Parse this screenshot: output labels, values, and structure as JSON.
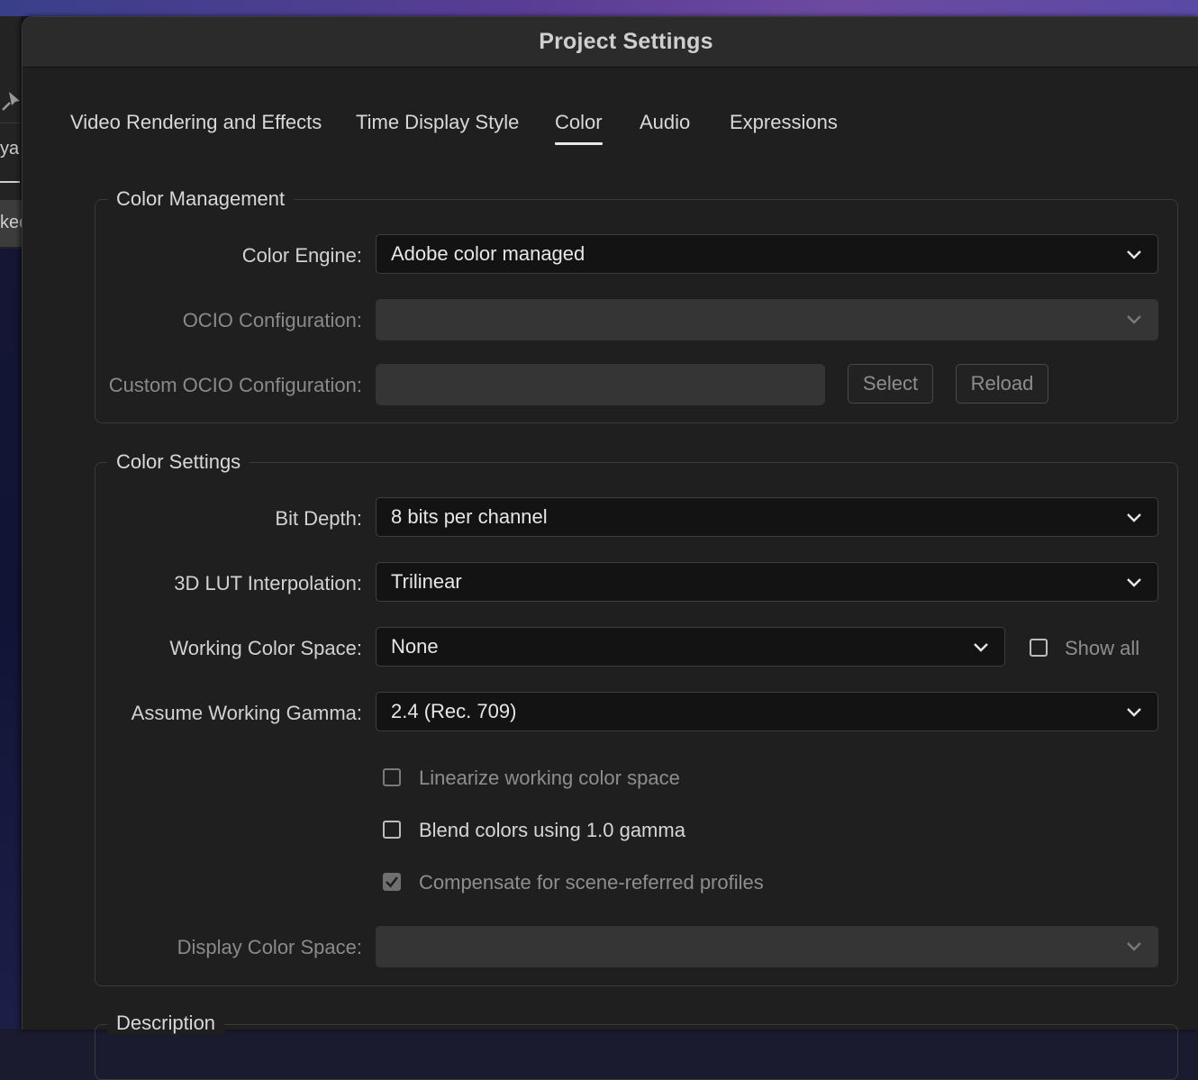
{
  "background": {
    "behind_text_1": "ya",
    "behind_text_2": "ked"
  },
  "dialog": {
    "title": "Project Settings"
  },
  "tabs": [
    {
      "label": "Video Rendering and Effects",
      "active": false
    },
    {
      "label": "Time Display Style",
      "active": false
    },
    {
      "label": "Color",
      "active": true
    },
    {
      "label": "Audio",
      "active": false
    },
    {
      "label": "Expressions",
      "active": false
    }
  ],
  "color_management": {
    "legend": "Color Management",
    "color_engine": {
      "label": "Color Engine:",
      "value": "Adobe color managed"
    },
    "ocio_configuration": {
      "label": "OCIO Configuration:",
      "value": ""
    },
    "custom_ocio": {
      "label": "Custom OCIO Configuration:",
      "value": ""
    },
    "select_label": "Select",
    "reload_label": "Reload"
  },
  "color_settings": {
    "legend": "Color Settings",
    "bit_depth": {
      "label": "Bit Depth:",
      "value": "8 bits per channel"
    },
    "lut_interp": {
      "label": "3D LUT Interpolation:",
      "value": "Trilinear"
    },
    "working_space": {
      "label": "Working Color Space:",
      "value": "None"
    },
    "show_all": {
      "label": "Show all",
      "checked": false
    },
    "working_gamma": {
      "label": "Assume Working Gamma:",
      "value": "2.4 (Rec. 709)"
    },
    "linearize": {
      "label": "Linearize working color space",
      "checked": false
    },
    "blend_gamma": {
      "label": "Blend colors using 1.0 gamma",
      "checked": false
    },
    "compensate": {
      "label": "Compensate for scene-referred profiles",
      "checked": true
    },
    "display_space": {
      "label": "Display Color Space:",
      "value": ""
    }
  },
  "description": {
    "legend": "Description"
  },
  "colors": {
    "dialog_bg": "#1f1f1f",
    "titlebar_bg": "#2b2b2b",
    "dropdown_bg": "#131313",
    "disabled_bg": "#353535"
  }
}
